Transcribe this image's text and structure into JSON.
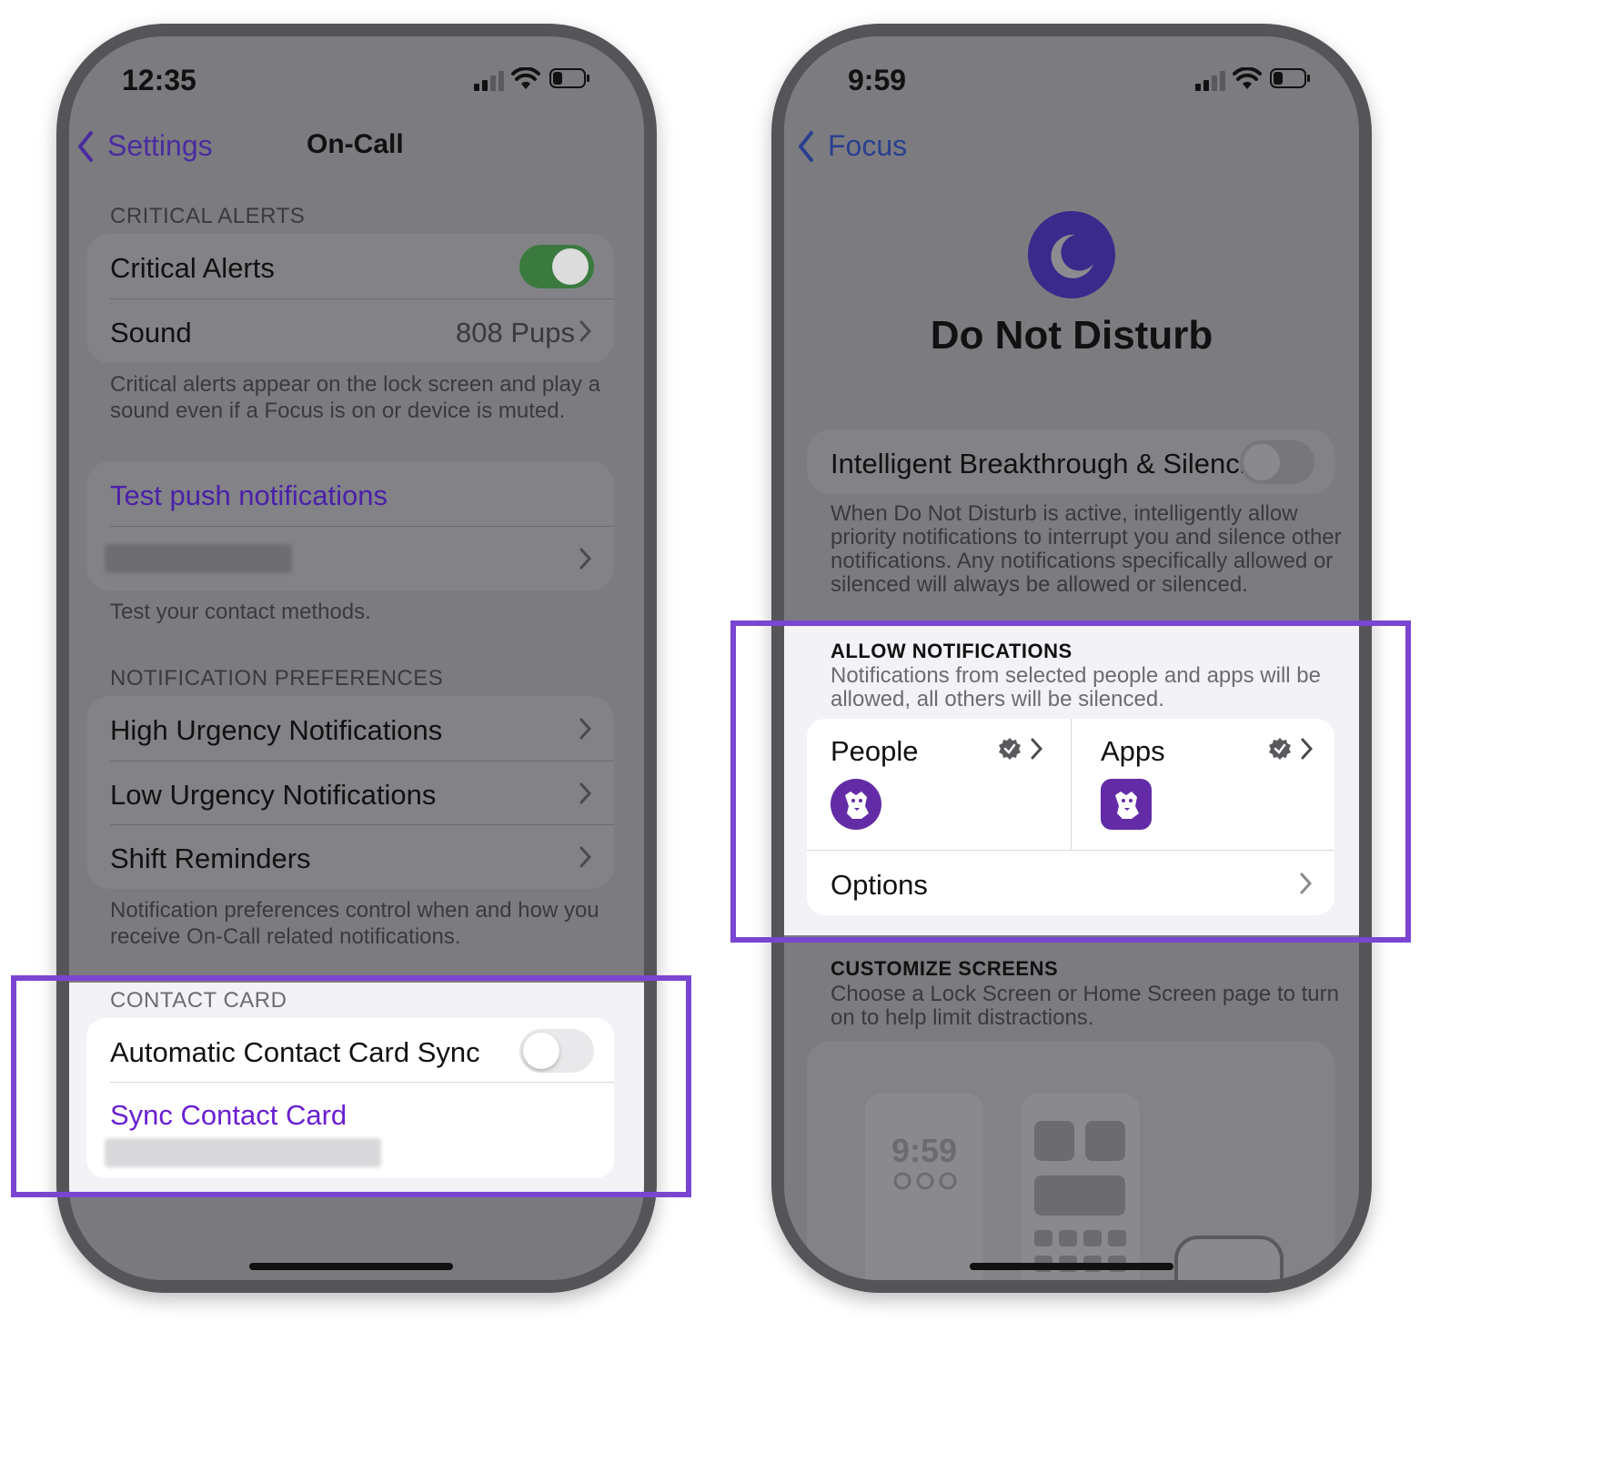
{
  "left": {
    "status": {
      "time": "12:35"
    },
    "nav": {
      "back_label": "Settings",
      "title": "On-Call"
    },
    "critical": {
      "header": "CRITICAL ALERTS",
      "alerts_label": "Critical Alerts",
      "alerts_on": true,
      "sound_label": "Sound",
      "sound_value": "808 Pups",
      "footer_1": "Critical alerts appear on the lock screen and play a",
      "footer_2": "sound even if a Focus is on or device is muted."
    },
    "test": {
      "push_label": "Test push notifications",
      "footer": "Test your contact methods."
    },
    "prefs": {
      "header": "NOTIFICATION PREFERENCES",
      "items": [
        "High Urgency Notifications",
        "Low Urgency Notifications",
        "Shift Reminders"
      ],
      "footer_1": "Notification preferences control when and how you",
      "footer_2": "receive On-Call related notifications."
    },
    "contact": {
      "header": "CONTACT CARD",
      "auto_sync_label": "Automatic Contact Card Sync",
      "auto_sync_on": false,
      "sync_label": "Sync Contact Card"
    }
  },
  "right": {
    "status": {
      "time": "9:59"
    },
    "nav": {
      "back_label": "Focus"
    },
    "title": "Do Not Disturb",
    "intelligent": {
      "label": "Intelligent Breakthrough & Silencing",
      "on": false,
      "footer_1": "When Do Not Disturb is active, intelligently allow",
      "footer_2": "priority notifications to interrupt you and silence other",
      "footer_3": "notifications. Any notifications specifically allowed or",
      "footer_4": "silenced will always be allowed or silenced."
    },
    "allow": {
      "header": "ALLOW NOTIFICATIONS",
      "desc_1": "Notifications from selected people and apps will be",
      "desc_2": "allowed, all others will be silenced.",
      "people_label": "People",
      "apps_label": "Apps",
      "options_label": "Options"
    },
    "customize": {
      "header": "CUSTOMIZE SCREENS",
      "desc_1": "Choose a Lock Screen or Home Screen page to turn",
      "desc_2": "on to help limit distractions.",
      "preview_time": "9:59"
    }
  },
  "colors": {
    "accent_purple": "#6a1fd1",
    "highlight_border": "#7a45d1",
    "toggle_green": "#34c759",
    "dnd_icon": "#3a2a8c"
  }
}
